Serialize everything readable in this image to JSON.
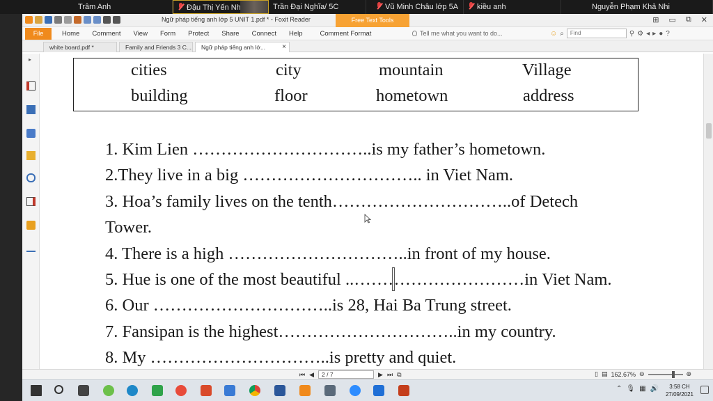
{
  "participants": [
    {
      "name": "Trâm Anh",
      "muted": false,
      "active": false
    },
    {
      "name": "Đậu Thị Yến Nhi",
      "muted": true,
      "active": true
    },
    {
      "name": "Trần Đại Nghĩa/ 5C",
      "muted": false,
      "active": false
    },
    {
      "name": "Vũ Minh Châu lớp 5A",
      "muted": true,
      "active": false
    },
    {
      "name": "kiều anh",
      "muted": true,
      "active": false
    },
    {
      "name": "Nguyễn Phạm Khả Nhi",
      "muted": false,
      "active": false
    }
  ],
  "window": {
    "title": "Ngữ pháp tiếng anh lớp 5  UNIT 1.pdf * - Foxit Reader",
    "tools_tab": "Free Text Tools"
  },
  "ribbon": {
    "file": "File",
    "menu": [
      "Home",
      "Comment",
      "View",
      "Form",
      "Protect",
      "Share",
      "Connect",
      "Help",
      "Comment Format"
    ],
    "tell_me": "Tell me what you want to do...",
    "find_placeholder": "Find"
  },
  "doc_tabs": [
    {
      "label": "white board.pdf *",
      "active": false
    },
    {
      "label": "Family and Friends 3 C...",
      "active": false
    },
    {
      "label": "Ngữ pháp tiếng anh lớ...",
      "active": true
    }
  ],
  "word_box": {
    "row1": [
      "cities",
      "city",
      "mountain",
      "Village"
    ],
    "row2": [
      "building",
      "floor",
      "hometown",
      "address"
    ]
  },
  "exercises": [
    "1. Kim Lien …………………………..is my father’s hometown.",
    "2.They live in a big ………………………….. in Viet Nam.",
    "3. Hoa’s family lives on the tenth…………………………..of  Detech",
    "Tower.",
    "4. There is a high …………………………..in front of my house.",
    "5. Hue is one of the most beautiful ..…………………………in Viet Nam.",
    "6. Our …………………………..is 28, Hai Ba Trung street.",
    "7. Fansipan is the highest…………………………..in my country.",
    "8. My …………………………..is pretty and quiet."
  ],
  "status": {
    "page": "2 / 7",
    "zoom": "162.67%"
  },
  "taskbar": {
    "time": "3:58 CH",
    "date": "27/09/2021"
  },
  "colors": {
    "accent_orange": "#f08a1c",
    "tools_tab": "#f7a233",
    "muted_mic": "#e04040"
  }
}
